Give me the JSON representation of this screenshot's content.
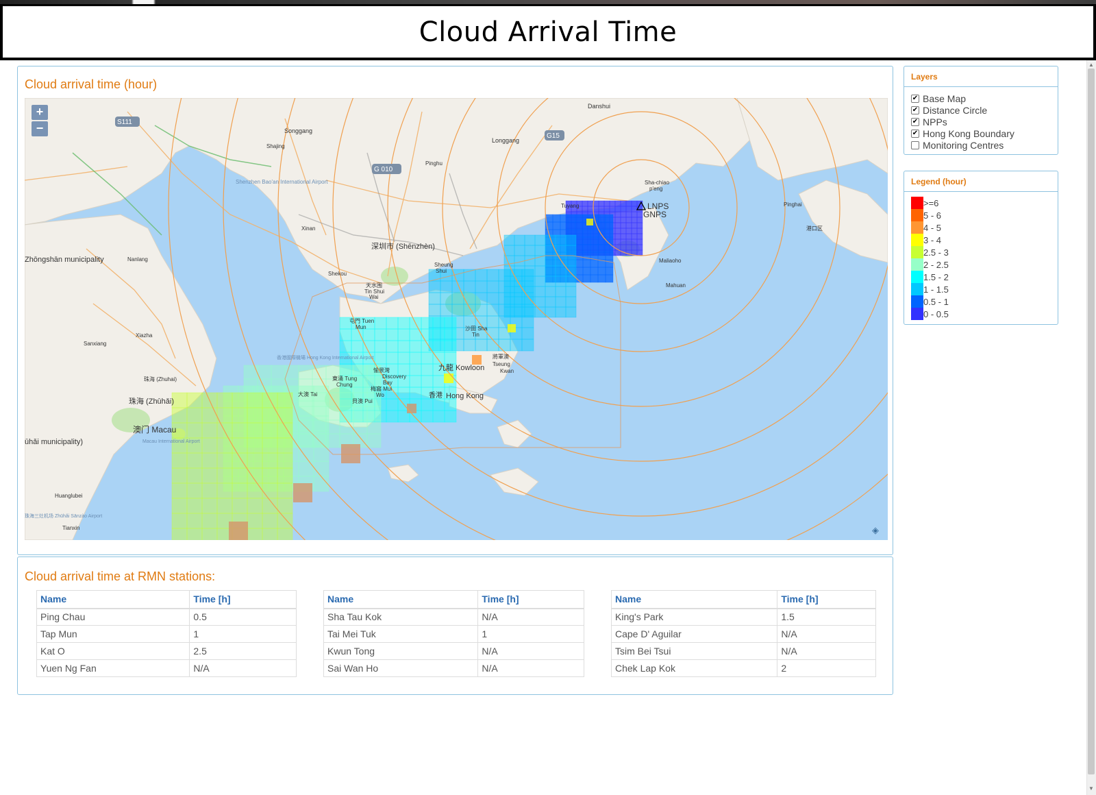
{
  "page": {
    "title": "Cloud Arrival Time"
  },
  "map_panel": {
    "title": "Cloud arrival time (hour)",
    "zoom_in": "+",
    "zoom_out": "−"
  },
  "map": {
    "labels": [
      "Danshui",
      "S111",
      "Songgang",
      "Shajing",
      "Longgang",
      "G15",
      "G 010",
      "Pinghu",
      "Shenzhen Bao'an International Airport",
      "Sha-chiao",
      "p'eng",
      "Tuyang",
      "Pinghai",
      "港口区",
      "Xinan",
      "深圳市 (Shēnzhèn)",
      "Nanlang",
      "Zhōngshān municipality",
      "Shekou",
      "Sheung",
      "Shui",
      "Maliaoho",
      "天水围",
      "Tin Shui",
      "Wai",
      "Mahuan",
      "屯門 Tuen",
      "Mun",
      "沙田 Sha",
      "Tin",
      "Xiazha",
      "Sanxiang",
      "香港國際機場 Hong Kong International Airport",
      "將軍澳",
      "Tseung",
      "Kwan",
      "O",
      "九龍 Kowloon",
      "東涌 Tung",
      "Chung",
      "愉景灣",
      "Discovery",
      "Bay",
      "珠海 (Zhuhai)",
      "珠海 (Zhūhǎi)",
      "梅窩 Mui",
      "Wo",
      "大澳 Tai",
      "貝澳 Pui",
      "香港",
      "Hong Kong",
      "澳门 Macau",
      "Macau International Airport",
      "ūhǎi municipality)",
      "Huanglubei",
      "珠海三灶机场 Zhūhǎi Sānzào Airport",
      "Tianxin"
    ],
    "npp_labels": [
      "LNPS",
      "GNPS"
    ]
  },
  "stations_panel": {
    "title": "Cloud arrival time at RMN stations:",
    "columns": [
      "Name",
      "Time [h]"
    ],
    "tables": [
      [
        [
          "Ping Chau",
          "0.5"
        ],
        [
          "Tap Mun",
          "1"
        ],
        [
          "Kat O",
          "2.5"
        ],
        [
          "Yuen Ng Fan",
          "N/A"
        ]
      ],
      [
        [
          "Sha Tau Kok",
          "N/A"
        ],
        [
          "Tai Mei Tuk",
          "1"
        ],
        [
          "Kwun Tong",
          "N/A"
        ],
        [
          "Sai Wan Ho",
          "N/A"
        ]
      ],
      [
        [
          "King's Park",
          "1.5"
        ],
        [
          "Cape D' Aguilar",
          "N/A"
        ],
        [
          "Tsim Bei Tsui",
          "N/A"
        ],
        [
          "Chek Lap Kok",
          "2"
        ]
      ]
    ]
  },
  "layers": {
    "title": "Layers",
    "items": [
      {
        "label": "Base Map",
        "checked": true
      },
      {
        "label": "Distance Circle",
        "checked": true
      },
      {
        "label": "NPPs",
        "checked": true
      },
      {
        "label": "Hong Kong Boundary",
        "checked": true
      },
      {
        "label": "Monitoring Centres",
        "checked": false
      }
    ]
  },
  "legend": {
    "title": "Legend (hour)",
    "items": [
      {
        "label": ">=6",
        "color": "#ff0000"
      },
      {
        "label": "5 - 6",
        "color": "#ff6400"
      },
      {
        "label": "4 - 5",
        "color": "#ff9632"
      },
      {
        "label": "3 - 4",
        "color": "#ffff00"
      },
      {
        "label": "2.5 - 3",
        "color": "#c8ff32"
      },
      {
        "label": "2 - 2.5",
        "color": "#96ffc8"
      },
      {
        "label": "1.5 - 2",
        "color": "#00ffff"
      },
      {
        "label": "1 - 1.5",
        "color": "#00c8ff"
      },
      {
        "label": "0.5 - 1",
        "color": "#0064ff"
      },
      {
        "label": "0 - 0.5",
        "color": "#3232ff"
      }
    ]
  },
  "colors": {
    "accent": "#e07b12",
    "header_link": "#2a6ab0",
    "panel_border": "#8ec3e0",
    "water": "#aad3f5",
    "land": "#f2efe9",
    "distance_circle": "#f0a050"
  }
}
